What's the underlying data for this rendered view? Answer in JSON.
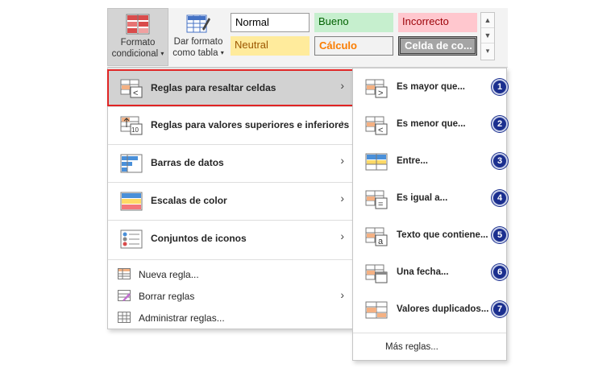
{
  "ribbon": {
    "conditional_format": {
      "line1": "Formato",
      "line2": "condicional",
      "icon": "conditional-format-icon"
    },
    "format_table": {
      "line1": "Dar formato",
      "line2": "como tabla",
      "icon": "format-as-table-icon"
    },
    "styles": {
      "normal": "Normal",
      "bueno": "Bueno",
      "incorrecto": "Incorrecto",
      "neutral": "Neutral",
      "calculo": "Cálculo",
      "celda": "Celda de co..."
    }
  },
  "menu": {
    "items": [
      {
        "label": "Reglas para resaltar celdas",
        "icon": "highlight-rules-icon",
        "has_submenu": true,
        "highlighted": true
      },
      {
        "label": "Reglas para valores superiores e inferiores",
        "icon": "top-bottom-rules-icon",
        "has_submenu": true
      },
      {
        "label": "Barras de datos",
        "icon": "data-bars-icon",
        "has_submenu": true
      },
      {
        "label": "Escalas de color",
        "icon": "color-scales-icon",
        "has_submenu": true
      },
      {
        "label": "Conjuntos de iconos",
        "icon": "icon-sets-icon",
        "has_submenu": true
      }
    ],
    "small_items": [
      {
        "label": "Nueva regla...",
        "icon": "new-rule-icon"
      },
      {
        "label": "Borrar reglas",
        "icon": "clear-rules-icon",
        "has_submenu": true
      },
      {
        "label": "Administrar reglas...",
        "icon": "manage-rules-icon"
      }
    ]
  },
  "submenu": {
    "items": [
      {
        "label": "Es mayor que...",
        "num": "1",
        "icon": "greater-than-icon"
      },
      {
        "label": "Es menor que...",
        "num": "2",
        "icon": "less-than-icon"
      },
      {
        "label": "Entre...",
        "num": "3",
        "icon": "between-icon"
      },
      {
        "label": "Es igual a...",
        "num": "4",
        "icon": "equal-to-icon"
      },
      {
        "label": "Texto que contiene...",
        "num": "5",
        "icon": "text-contains-icon"
      },
      {
        "label": "Una fecha...",
        "num": "6",
        "icon": "date-occurring-icon"
      },
      {
        "label": "Valores duplicados...",
        "num": "7",
        "icon": "duplicate-values-icon"
      }
    ],
    "more": "Más reglas..."
  },
  "colors": {
    "highlight_border": "#e02424",
    "badge": "#1b2f8f"
  }
}
